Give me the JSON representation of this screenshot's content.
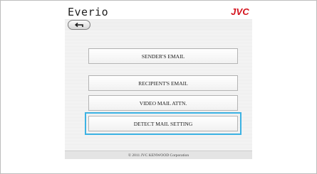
{
  "header": {
    "brand": "Everio",
    "logo": "JVC",
    "logo_color": "#d4121c"
  },
  "nav": {
    "back_icon": "back-arrow-icon"
  },
  "menu": {
    "items": [
      {
        "label": "SENDER'S EMAIL",
        "selected": false
      },
      {
        "label": "RECIPIENT'S EMAIL",
        "selected": false
      },
      {
        "label": "VIDEO MAIL ATTN.",
        "selected": false
      },
      {
        "label": "DETECT MAIL SETTING",
        "selected": true
      }
    ],
    "highlight_color": "#3cb2e3"
  },
  "footer": {
    "copyright": "© 2011 JVC KENWOOD Corporation"
  }
}
